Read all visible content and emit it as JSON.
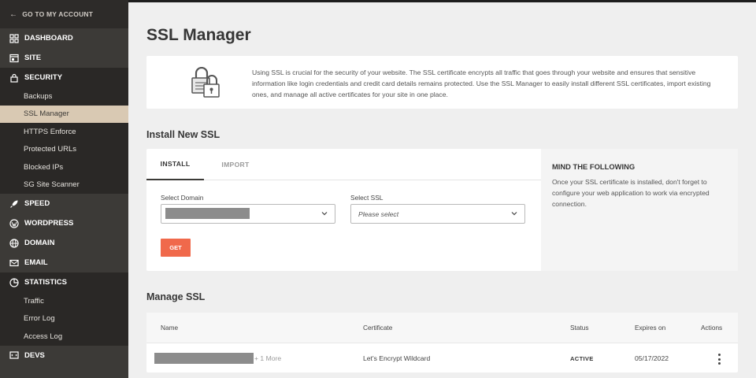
{
  "sidebar": {
    "back_label": "GO TO MY ACCOUNT",
    "items": [
      {
        "label": "DASHBOARD",
        "icon": "dashboard-icon"
      },
      {
        "label": "SITE",
        "icon": "site-icon"
      },
      {
        "label": "SECURITY",
        "icon": "lock-icon",
        "open": true,
        "subitems": [
          "Backups",
          "SSL Manager",
          "HTTPS Enforce",
          "Protected URLs",
          "Blocked IPs",
          "SG Site Scanner"
        ],
        "active_subitem": "SSL Manager"
      },
      {
        "label": "SPEED",
        "icon": "rocket-icon"
      },
      {
        "label": "WORDPRESS",
        "icon": "wordpress-icon"
      },
      {
        "label": "DOMAIN",
        "icon": "globe-icon"
      },
      {
        "label": "EMAIL",
        "icon": "email-icon"
      },
      {
        "label": "STATISTICS",
        "icon": "pie-chart-icon",
        "open": true,
        "subitems": [
          "Traffic",
          "Error Log",
          "Access Log"
        ]
      },
      {
        "label": "DEVS",
        "icon": "code-icon"
      }
    ]
  },
  "page": {
    "title": "SSL Manager",
    "info_text": "Using SSL is crucial for the security of your website. The SSL certificate encrypts all traffic that goes through your website and ensures that sensitive information like login credentials and credit card details remains protected. Use the SSL Manager to easily install different SSL certificates, import existing ones, and manage all active certificates for your site in one place."
  },
  "install": {
    "section_title": "Install New SSL",
    "tabs": [
      "INSTALL",
      "IMPORT"
    ],
    "active_tab": "INSTALL",
    "domain_label": "Select Domain",
    "ssl_label": "Select SSL",
    "ssl_placeholder": "Please select",
    "get_button": "GET",
    "mind_title": "MIND THE FOLLOWING",
    "mind_text": "Once your SSL certificate is installed, don't forget to configure your web application to work via encrypted connection."
  },
  "manage": {
    "section_title": "Manage SSL",
    "columns": [
      "Name",
      "Certificate",
      "Status",
      "Expires on",
      "Actions"
    ],
    "rows": [
      {
        "name_more": "+ 1 More",
        "certificate": "Let's Encrypt Wildcard",
        "status": "ACTIVE",
        "expires": "05/17/2022"
      }
    ]
  },
  "colors": {
    "sidebar_bg": "#3c3a37",
    "active_item_bg": "#d9c9b3",
    "accent_button": "#f0694b"
  }
}
